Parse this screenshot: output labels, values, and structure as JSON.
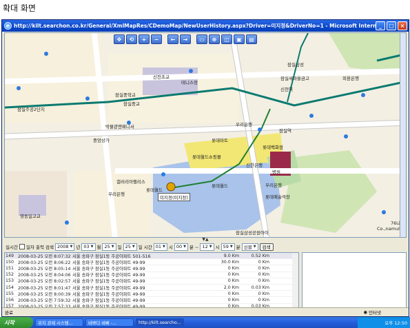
{
  "caption": "확대 화면",
  "window": {
    "title": "http://kilt.searchon.co.kr/General/XmlMapRes/CDemoMap/NewUserHistory.aspx?Driver=미지정&DriverNo=1 - Microsoft Internet Explorer",
    "minimize": "_",
    "maximize": "□",
    "close": "×"
  },
  "map": {
    "toolbar": [
      "✥",
      "⟲",
      "+",
      "−",
      "←",
      "→",
      "▭",
      "⊕",
      "◫",
      "▣",
      "▤"
    ],
    "labels": {
      "school1": "신천초교",
      "tennis": "테니스장",
      "jamsil_middle": "잠실중학교",
      "jamsil_dong": "잠실동주민센터",
      "jamsil_middle2": "잠실중교",
      "jamsil2danji": "잠실주공2단지",
      "bakmul": "박물관엔웨니서",
      "jungang": "중앙상가",
      "lottemart": "롯데마트",
      "woori1": "우리은행",
      "lotteworld_mall": "롯데월드쇼핑몰",
      "lotte_hotel": "롯데월드",
      "galleria": "갤러리아팰리스",
      "woori2": "우리은행",
      "lotte_dept": "롯데월드",
      "lottebakhwajeom": "롯데백화점",
      "sincheon_bank": "신한은행",
      "hospital": "병원",
      "jamsil_station": "잠실역",
      "jamsil_stn2": "잠실역",
      "gonglyu": "신천역",
      "seokchon": "잠실새마을금고",
      "jamsil_samsung": "잠실삼성",
      "yeongdong_high": "영동일고교",
      "songpa": "송파구청",
      "lotte_art": "롯데예술극장",
      "woori3": "우리은행",
      "hyundai": "현대아파트",
      "jamsil3": "잠실삼성공원아이",
      "vehicle_tag": "미지정(미지정)",
      "oe_hwan": "외환은행",
      "corner": "76나",
      "cornernamul": "Co.,namul"
    }
  },
  "filter": {
    "label_realtime": "실시간",
    "label_range": "일자 출력 검색",
    "year": "2008",
    "year_unit": "년",
    "month": "03",
    "month_unit": "월",
    "day": "25",
    "day_unit": "일",
    "day2": "25",
    "day2_unit": "일",
    "hour_label": "시간",
    "hour1": "01",
    "hour1_unit": "시",
    "min1": "00",
    "min1_unit": "분 ~",
    "hour2": "12",
    "hour2_unit": "시",
    "min2": "59",
    "min2_unit": "분",
    "kind": "신블",
    "search": "검색"
  },
  "table": {
    "rows": [
      {
        "no": "149",
        "time": "2008-03-25 오전 8:07:32",
        "addr": "서울 송파구 잠실1동 주공아파트 501-516",
        "dist": "9.0 Km",
        "speed": "0.52 Km"
      },
      {
        "no": "150",
        "time": "2008-03-25 오전 8:06:22",
        "addr": "서울 송파구 잠실1동 주공아파트 49-99",
        "dist": "30.0 Km",
        "speed": "0 Km"
      },
      {
        "no": "151",
        "time": "2008-03-25 오전 8:05:14",
        "addr": "서울 송파구 잠실1동 주공아파트 49-99",
        "dist": "0 Km",
        "speed": "0 Km"
      },
      {
        "no": "152",
        "time": "2008-03-25 오전 8:04:06",
        "addr": "서울 송파구 잠실1동 주공아파트 49-99",
        "dist": "0 Km",
        "speed": "0 Km"
      },
      {
        "no": "153",
        "time": "2008-03-25 오전 8:02:57",
        "addr": "서울 송파구 잠실1동 주공아파트 49-99",
        "dist": "0 Km",
        "speed": "0 Km"
      },
      {
        "no": "154",
        "time": "2008-03-25 오전 8:01:47",
        "addr": "서울 송파구 잠실1동 주공아파트 49-99",
        "dist": "2.0 Km",
        "speed": "0.03 Km"
      },
      {
        "no": "155",
        "time": "2008-03-25 오전 8:00:39",
        "addr": "서울 송파구 잠실1동 주공아파트 49-99",
        "dist": "0 Km",
        "speed": "0 Km"
      },
      {
        "no": "156",
        "time": "2008-03-25 오전 7:59:32",
        "addr": "서울 송파구 잠실1동 주공아파트 49-99",
        "dist": "0 Km",
        "speed": "0 Km"
      },
      {
        "no": "157",
        "time": "2008-03-25 오전 7:57:33",
        "addr": "서울 송파구 잠실1동 주공아파트 49-99",
        "dist": "0 Km",
        "speed": "0.03 Km"
      }
    ]
  },
  "status": {
    "left": "완료",
    "zone": "인터넷"
  },
  "taskbar": {
    "start": "시작",
    "tasks": [
      "위치 관제 시스템...",
      "바쁘다 바빠 -...",
      "http://kilt.searcho..."
    ],
    "clock": "오후 12:50"
  }
}
